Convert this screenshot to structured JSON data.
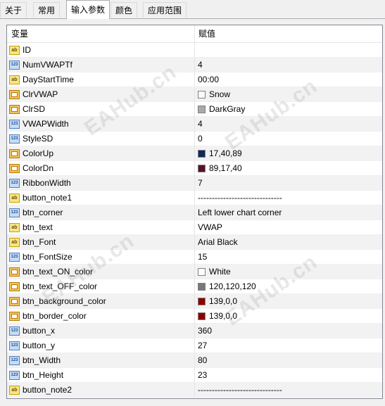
{
  "tabs": [
    {
      "label": "关于"
    },
    {
      "label": "常用"
    },
    {
      "label": "输入参数"
    },
    {
      "label": "颜色"
    },
    {
      "label": "应用范围"
    }
  ],
  "table": {
    "header": {
      "variable": "变量",
      "value": "赋值"
    },
    "rows": [
      {
        "icon": "ab",
        "name": "ID",
        "value": ""
      },
      {
        "icon": "123",
        "name": "NumVWAPTf",
        "value": "4"
      },
      {
        "icon": "ab",
        "name": "DayStartTime",
        "value": "00:00"
      },
      {
        "icon": "color",
        "name": "ClrVWAP",
        "value": "Snow",
        "swatch": "#fffafa"
      },
      {
        "icon": "color",
        "name": "ClrSD",
        "value": "DarkGray",
        "swatch": "#a9a9a9"
      },
      {
        "icon": "123",
        "name": "VWAPWidth",
        "value": "4"
      },
      {
        "icon": "123",
        "name": "StyleSD",
        "value": "0"
      },
      {
        "icon": "color",
        "name": "ColorUp",
        "value": "17,40,89",
        "swatch": "#112859"
      },
      {
        "icon": "color",
        "name": "ColorDn",
        "value": "89,17,40",
        "swatch": "#591128"
      },
      {
        "icon": "123",
        "name": "RibbonWidth",
        "value": "7"
      },
      {
        "icon": "ab",
        "name": "button_note1",
        "value": "------------------------------"
      },
      {
        "icon": "123",
        "name": "btn_corner",
        "value": "Left lower chart corner"
      },
      {
        "icon": "ab",
        "name": "btn_text",
        "value": "VWAP"
      },
      {
        "icon": "ab",
        "name": "btn_Font",
        "value": "Arial Black"
      },
      {
        "icon": "123",
        "name": "btn_FontSize",
        "value": "15"
      },
      {
        "icon": "color",
        "name": "btn_text_ON_color",
        "value": "White",
        "swatch": "#ffffff"
      },
      {
        "icon": "color",
        "name": "btn_text_OFF_color",
        "value": "120,120,120",
        "swatch": "#787878"
      },
      {
        "icon": "color",
        "name": "btn_background_color",
        "value": "139,0,0",
        "swatch": "#8b0000"
      },
      {
        "icon": "color",
        "name": "btn_border_color",
        "value": "139,0,0",
        "swatch": "#8b0000"
      },
      {
        "icon": "123",
        "name": "button_x",
        "value": "360"
      },
      {
        "icon": "123",
        "name": "button_y",
        "value": "27"
      },
      {
        "icon": "123",
        "name": "btn_Width",
        "value": "80"
      },
      {
        "icon": "123",
        "name": "btn_Height",
        "value": "23"
      },
      {
        "icon": "ab",
        "name": "button_note2",
        "value": "------------------------------"
      }
    ]
  },
  "watermark": "EAHub.cn"
}
